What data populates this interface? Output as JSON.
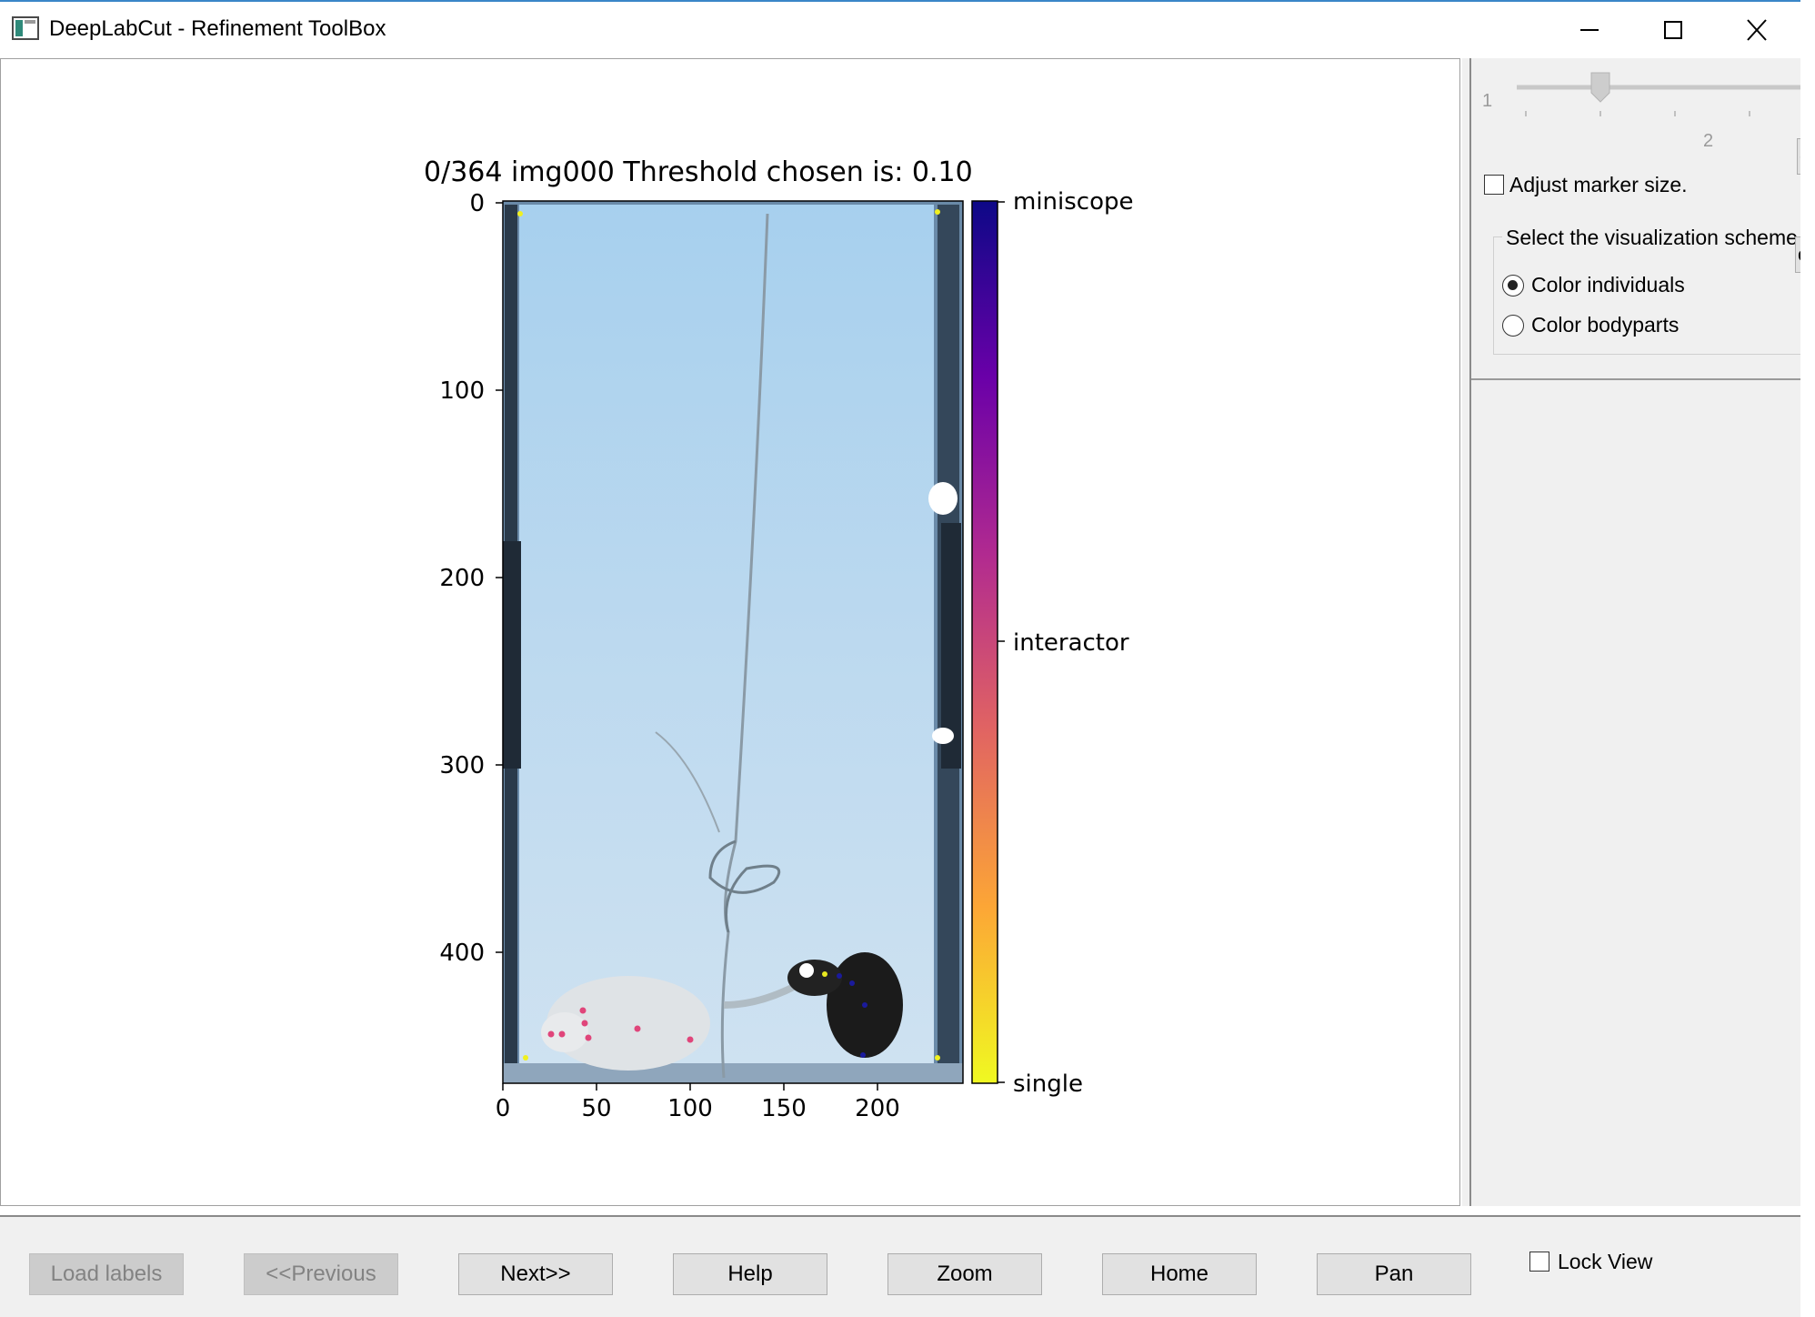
{
  "window": {
    "title": "DeepLabCut - Refinement ToolBox",
    "controls": [
      "minimize-icon",
      "maximize-icon",
      "close-icon"
    ]
  },
  "plot": {
    "title": "0/364 img000  Threshold chosen is: 0.10",
    "image": "video frame: two mice (white and black) in a blue-lit arena with a tether cable",
    "x_ticks": [
      "0",
      "50",
      "100",
      "150",
      "200"
    ],
    "y_ticks": [
      "0",
      "100",
      "200",
      "300",
      "400"
    ],
    "colorbar": {
      "colormap": "plasma",
      "labels": [
        "miniscope",
        "interactor",
        "single"
      ]
    },
    "markers": {
      "white_mouse_color": "#e0457a",
      "black_mouse_color": "#1a1a9c",
      "corner_color": "#f0f020"
    }
  },
  "right_panel": {
    "slider": {
      "min_label": "1",
      "mid_label": "2",
      "value": 1.5
    },
    "side_button_fragment": "e",
    "adjust_marker_size": {
      "label": "Adjust marker size.",
      "checked": false
    },
    "visualization": {
      "group_label": "Select the visualization scheme",
      "group_fragment": "et",
      "options": [
        {
          "label": "Color individuals",
          "selected": true
        },
        {
          "label": "Color bodyparts",
          "selected": false
        }
      ]
    }
  },
  "toolbar": {
    "buttons": [
      {
        "label": "Load labels",
        "enabled": false
      },
      {
        "label": "<<Previous",
        "enabled": false
      },
      {
        "label": "Next>>",
        "enabled": true
      },
      {
        "label": "Help",
        "enabled": true
      },
      {
        "label": "Zoom",
        "enabled": true
      },
      {
        "label": "Home",
        "enabled": true
      },
      {
        "label": "Pan",
        "enabled": true
      }
    ],
    "lock_view": {
      "label": "Lock View",
      "checked": false
    }
  }
}
